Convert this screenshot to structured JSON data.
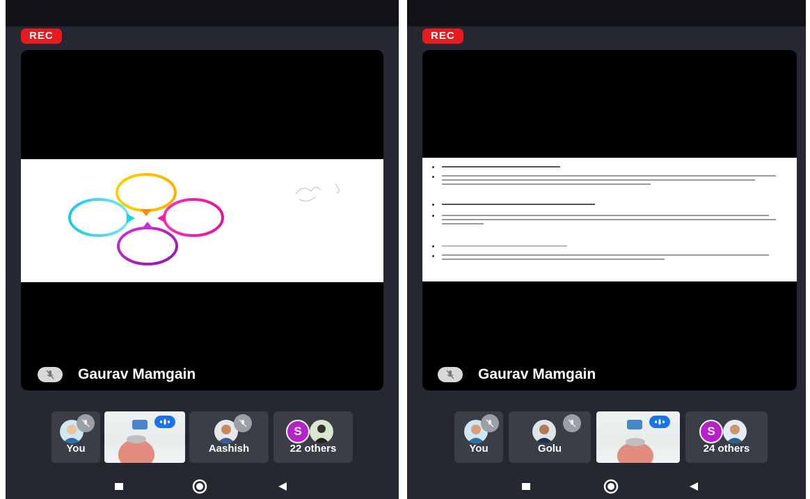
{
  "left_screen": {
    "rec_label": "REC",
    "speaker_name": "Gaurav Mamgain",
    "participants": [
      {
        "label": "You"
      },
      {
        "label": "Aashish"
      },
      {
        "label": "22 others",
        "badge": "S"
      }
    ]
  },
  "right_screen": {
    "rec_label": "REC",
    "speaker_name": "Gaurav Mamgain",
    "participants": [
      {
        "label": "You"
      },
      {
        "label": "Golu"
      },
      {
        "label": "24 others",
        "badge": "S"
      }
    ]
  },
  "icons": [
    "recent-apps-icon",
    "home-icon",
    "back-icon",
    "mic-off-icon",
    "speaking-indicator-icon"
  ],
  "colors": {
    "rec": "#e8191f",
    "others_badge": "#b820c9",
    "speaking": "#1a73e8"
  }
}
